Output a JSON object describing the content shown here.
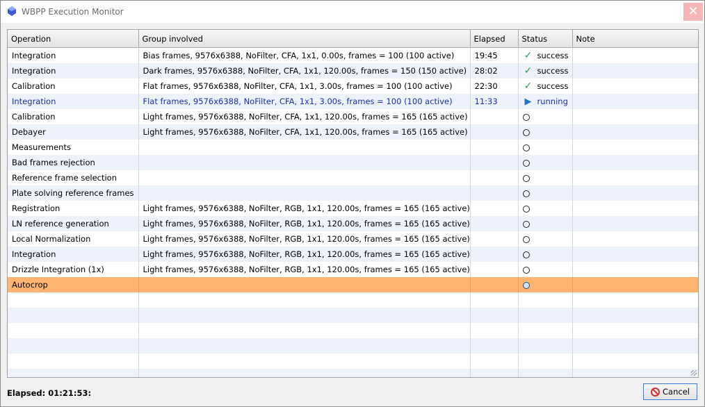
{
  "window": {
    "title": "WBPP Execution Monitor",
    "close_glyph": "✕"
  },
  "columns": [
    "Operation",
    "Group involved",
    "Elapsed",
    "Status",
    "Note"
  ],
  "rows": [
    {
      "operation": "Integration",
      "group": "Bias frames, 9576x6388, NoFilter, CFA, 1x1, 0.00s, frames = 100 (100 active)",
      "elapsed": "19:45",
      "status": "success",
      "status_icon": "check-icon",
      "note": ""
    },
    {
      "operation": "Integration",
      "group": "Dark frames, 9576x6388, NoFilter, CFA, 1x1, 120.00s, frames = 150 (150 active)",
      "elapsed": "28:02",
      "status": "success",
      "status_icon": "check-icon",
      "note": ""
    },
    {
      "operation": "Calibration",
      "group": "Flat frames, 9576x6388, NoFilter, CFA, 1x1, 3.00s, frames = 100 (100 active)",
      "elapsed": "22:30",
      "status": "success",
      "status_icon": "check-icon",
      "note": ""
    },
    {
      "operation": "Integration",
      "group": "Flat frames, 9576x6388, NoFilter, CFA, 1x1, 3.00s, frames = 100 (100 active)",
      "elapsed": "11:33",
      "status": "running",
      "status_icon": "play-icon",
      "note": ""
    },
    {
      "operation": "Calibration",
      "group": "Light frames, 9576x6388, NoFilter, CFA, 1x1, 120.00s, frames = 165 (165 active)",
      "elapsed": "",
      "status": "",
      "status_icon": "pending-icon",
      "note": ""
    },
    {
      "operation": "Debayer",
      "group": "Light frames, 9576x6388, NoFilter, CFA, 1x1, 120.00s, frames = 165 (165 active)",
      "elapsed": "",
      "status": "",
      "status_icon": "pending-icon",
      "note": ""
    },
    {
      "operation": "Measurements",
      "group": "",
      "elapsed": "",
      "status": "",
      "status_icon": "pending-icon",
      "note": ""
    },
    {
      "operation": "Bad frames rejection",
      "group": "",
      "elapsed": "",
      "status": "",
      "status_icon": "pending-icon",
      "note": ""
    },
    {
      "operation": "Reference frame selection",
      "group": "",
      "elapsed": "",
      "status": "",
      "status_icon": "pending-icon",
      "note": ""
    },
    {
      "operation": "Plate solving reference frames",
      "group": "",
      "elapsed": "",
      "status": "",
      "status_icon": "pending-icon",
      "note": ""
    },
    {
      "operation": "Registration",
      "group": "Light frames, 9576x6388, NoFilter, RGB, 1x1, 120.00s, frames = 165 (165 active)",
      "elapsed": "",
      "status": "",
      "status_icon": "pending-icon",
      "note": ""
    },
    {
      "operation": "LN reference generation",
      "group": "Light frames, 9576x6388, NoFilter, RGB, 1x1, 120.00s, frames = 165 (165 active)",
      "elapsed": "",
      "status": "",
      "status_icon": "pending-icon",
      "note": ""
    },
    {
      "operation": "Local Normalization",
      "group": "Light frames, 9576x6388, NoFilter, RGB, 1x1, 120.00s, frames = 165 (165 active)",
      "elapsed": "",
      "status": "",
      "status_icon": "pending-icon",
      "note": ""
    },
    {
      "operation": "Integration",
      "group": "Light frames, 9576x6388, NoFilter, RGB, 1x1, 120.00s, frames = 165 (165 active)",
      "elapsed": "",
      "status": "",
      "status_icon": "pending-icon",
      "note": ""
    },
    {
      "operation": "Drizzle Integration (1x)",
      "group": "Light frames, 9576x6388, NoFilter, RGB, 1x1, 120.00s, frames = 165 (165 active)",
      "elapsed": "",
      "status": "",
      "status_icon": "pending-icon",
      "note": ""
    },
    {
      "operation": "Autocrop",
      "group": "",
      "elapsed": "",
      "status": "",
      "status_icon": "pending-icon",
      "note": "",
      "selected": true
    }
  ],
  "footer": {
    "elapsed_label": "Elapsed: 01:21:53:",
    "cancel_label": "Cancel"
  },
  "colors": {
    "selected_row": "#ffb470",
    "running_text": "#1b2fa8",
    "success_icon": "#2a9a55",
    "alt_row": "#eef3fb"
  }
}
